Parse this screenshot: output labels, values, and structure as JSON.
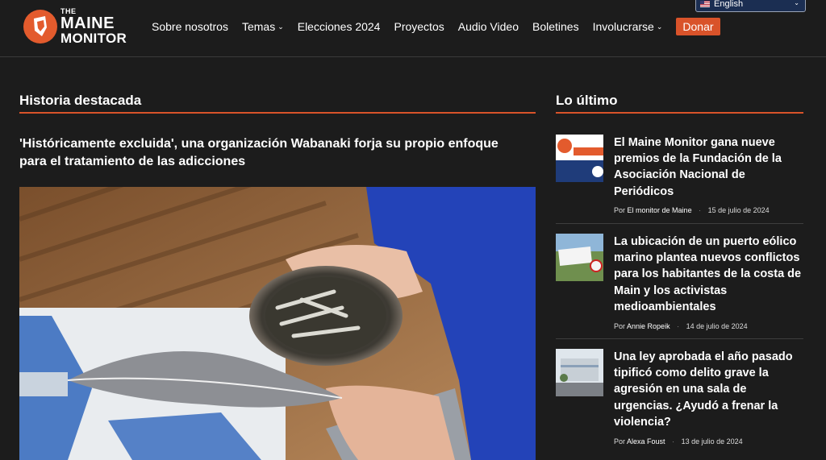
{
  "logo": {
    "the": "THE",
    "maine": "MAINE",
    "monitor": "MONITOR"
  },
  "nav": {
    "items": [
      {
        "label": "Sobre nosotros",
        "has_dropdown": false
      },
      {
        "label": "Temas",
        "has_dropdown": true
      },
      {
        "label": "Elecciones 2024",
        "has_dropdown": false
      },
      {
        "label": "Proyectos",
        "has_dropdown": false
      },
      {
        "label": "Audio Video",
        "has_dropdown": false
      },
      {
        "label": "Boletines",
        "has_dropdown": false
      },
      {
        "label": "Involucrarse",
        "has_dropdown": true
      }
    ],
    "donate_label": "Donar"
  },
  "language": {
    "selected": "English",
    "icon": "us-flag-icon"
  },
  "featured": {
    "section_title": "Historia destacada",
    "title": "'Históricamente excluida', una organización Wabanaki forja su propio enfoque para el tratamiento de las adicciones"
  },
  "latest": {
    "section_title": "Lo último",
    "posts": [
      {
        "title": "El Maine Monitor gana nueve premios de la Fundación de la Asociación Nacional de Periódicos",
        "by": "Por",
        "author": "El monitor de Maine",
        "date": "15 de julio de 2024"
      },
      {
        "title": "La ubicación de un puerto eólico marino plantea nuevos conflictos para los habitantes de la costa de Main y los activistas medioambientales",
        "by": "Por",
        "author": "Annie Ropeik",
        "date": "14 de julio de 2024"
      },
      {
        "title": "Una ley aprobada el año pasado tipificó como delito grave la agresión en una sala de urgencias. ¿Ayudó a frenar la violencia?",
        "by": "Por",
        "author": "Alexa Foust",
        "date": "13 de julio de 2024"
      }
    ]
  },
  "colors": {
    "background": "#1c1c1c",
    "accent": "#d9532a",
    "language_box": "#1b2e52"
  }
}
